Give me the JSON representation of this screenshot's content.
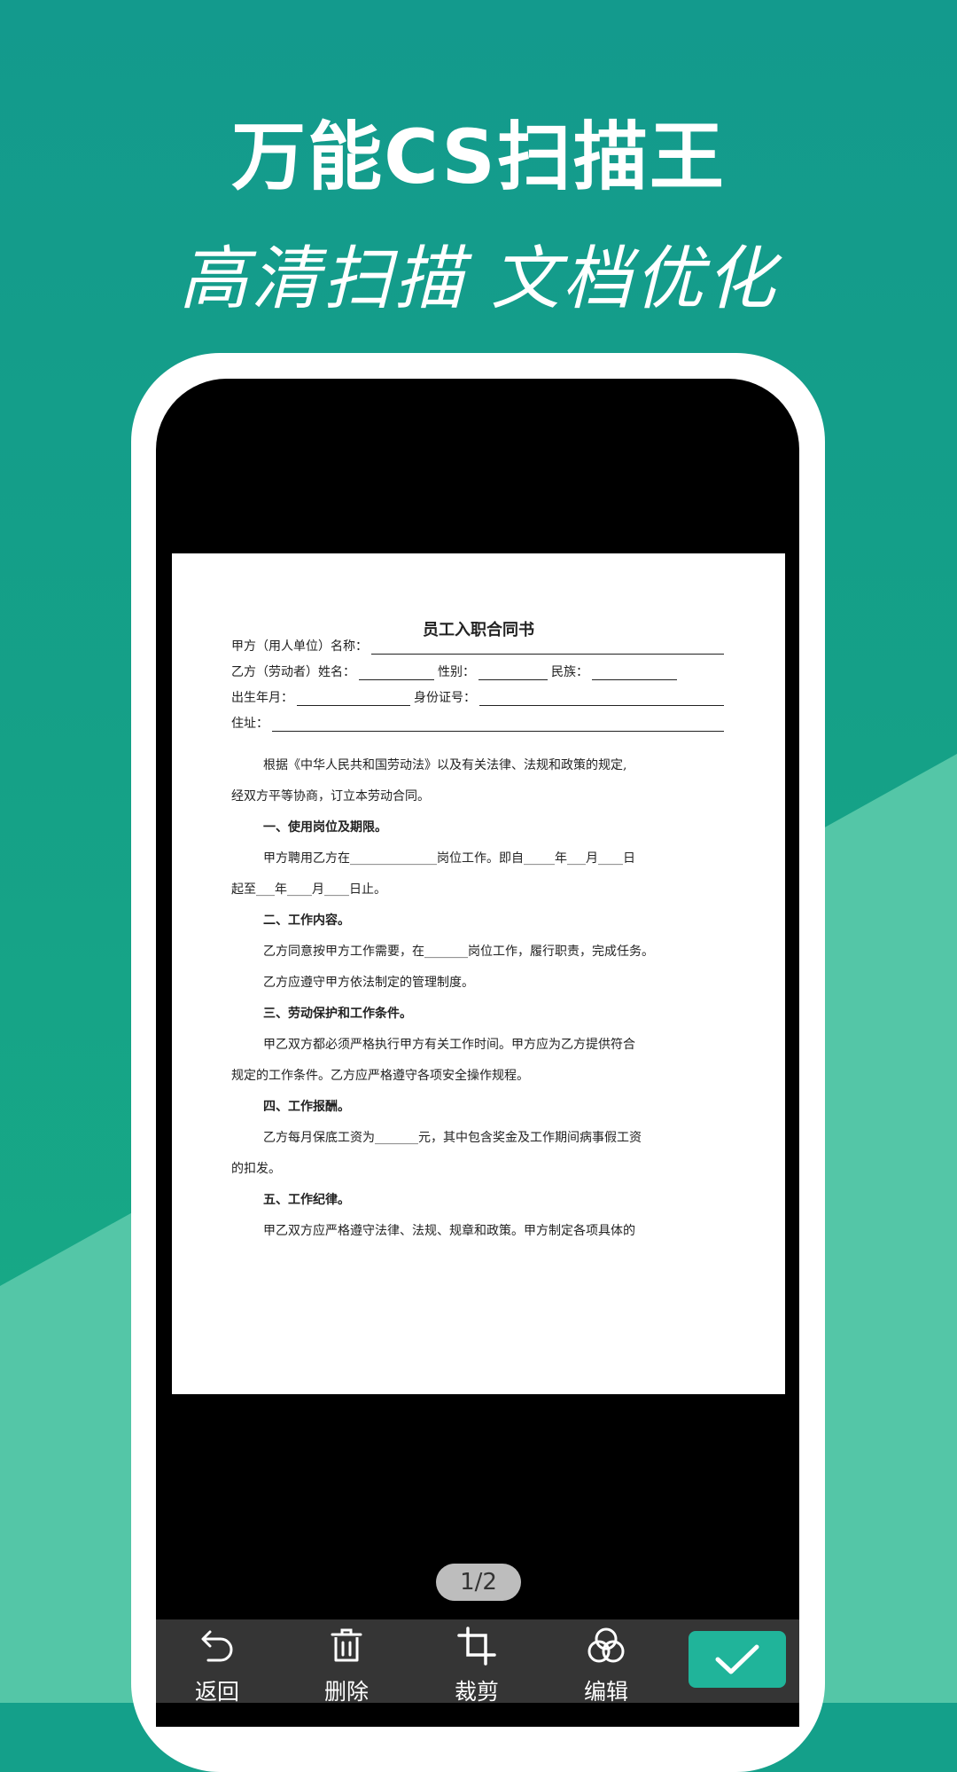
{
  "promo": {
    "title": "万能CS扫描王",
    "subtitle": "高清扫描 文档优化"
  },
  "document": {
    "title": "员工入职合同书",
    "fields": {
      "party_a": "甲方（用人单位）名称：",
      "party_b_name": "乙方（劳动者）姓名：",
      "gender": "性别：",
      "ethnicity": "民族：",
      "birth": "出生年月：",
      "id_no": "身份证号：",
      "address": "住址："
    },
    "paragraphs": [
      "根据《中华人民共和国劳动法》以及有关法律、法规和政策的规定,",
      "经双方平等协商，订立本劳动合同。",
      "一、使用岗位及期限。",
      "甲方聘用乙方在______________岗位工作。即自_____年___月____日",
      "起至___年____月____日止。",
      "二、工作内容。",
      "乙方同意按甲方工作需要，在_______岗位工作，履行职责，完成任务。",
      "乙方应遵守甲方依法制定的管理制度。",
      "三、劳动保护和工作条件。",
      "甲乙双方都必须严格执行甲方有关工作时间。甲方应为乙方提供符合",
      "规定的工作条件。乙方应严格遵守各项安全操作规程。",
      "四、工作报酬。",
      "乙方每月保底工资为_______元，其中包含奖金及工作期间病事假工资",
      "的扣发。",
      "五、工作纪律。",
      "甲乙双方应严格遵守法律、法规、规章和政策。甲方制定各项具体的"
    ]
  },
  "page_indicator": "1/2",
  "toolbar": {
    "back": "返回",
    "delete": "删除",
    "crop": "裁剪",
    "edit": "编辑"
  },
  "icons": {
    "back": "undo-arrow-icon",
    "delete": "trash-icon",
    "crop": "crop-icon",
    "edit": "filter-circles-icon",
    "confirm": "checkmark-icon"
  },
  "colors": {
    "brand": "#14a08a",
    "accent": "#20b49a",
    "toolbar": "#353535"
  }
}
